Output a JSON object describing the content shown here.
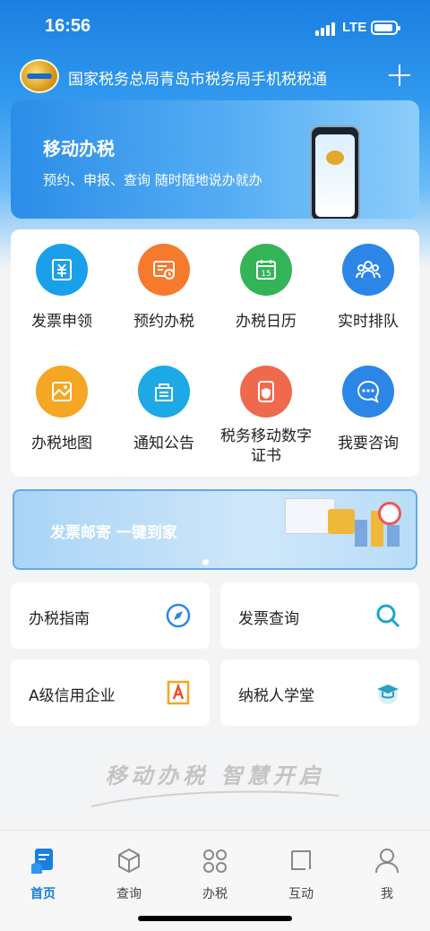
{
  "status": {
    "time": "16:56",
    "network": "LTE"
  },
  "header": {
    "title": "国家税务总局青岛市税务局手机税税通"
  },
  "hero": {
    "title": "移动办税",
    "subtitle": "预约、申报、查询 随时随地说办就办"
  },
  "services": [
    {
      "label": "发票申领",
      "icon": "invoice-icon",
      "color": "#1aa0ea"
    },
    {
      "label": "预约办税",
      "icon": "appointment-icon",
      "color": "#f57a2c"
    },
    {
      "label": "办税日历",
      "icon": "calendar-icon",
      "color": "#33b456"
    },
    {
      "label": "实时排队",
      "icon": "queue-icon",
      "color": "#2c86e6"
    },
    {
      "label": "办税地图",
      "icon": "map-icon",
      "color": "#f5a623"
    },
    {
      "label": "通知公告",
      "icon": "notice-icon",
      "color": "#1ca9e6"
    },
    {
      "label": "税务移动数字证书",
      "icon": "certificate-icon",
      "color": "#ef6a4d"
    },
    {
      "label": "我要咨询",
      "icon": "chat-icon",
      "color": "#2c86e6"
    }
  ],
  "banner": {
    "text": "发票邮寄  一键到家",
    "page_index": 1,
    "page_count": 3
  },
  "tiles": [
    {
      "label": "办税指南",
      "icon": "compass-icon"
    },
    {
      "label": "发票查询",
      "icon": "search-icon"
    },
    {
      "label": "A级信用企业",
      "icon": "a-grade-icon"
    },
    {
      "label": "纳税人学堂",
      "icon": "graduation-cap-icon"
    }
  ],
  "slogan": "移动办税  智慧开启",
  "tabbar": [
    {
      "label": "首页",
      "icon": "home-icon",
      "active": true
    },
    {
      "label": "查询",
      "icon": "cube-icon",
      "active": false
    },
    {
      "label": "办税",
      "icon": "apps-icon",
      "active": false
    },
    {
      "label": "互动",
      "icon": "interact-icon",
      "active": false
    },
    {
      "label": "我",
      "icon": "user-icon",
      "active": false
    }
  ],
  "colors": {
    "primary": "#1a7fe0",
    "background": "#f3f4f6"
  }
}
